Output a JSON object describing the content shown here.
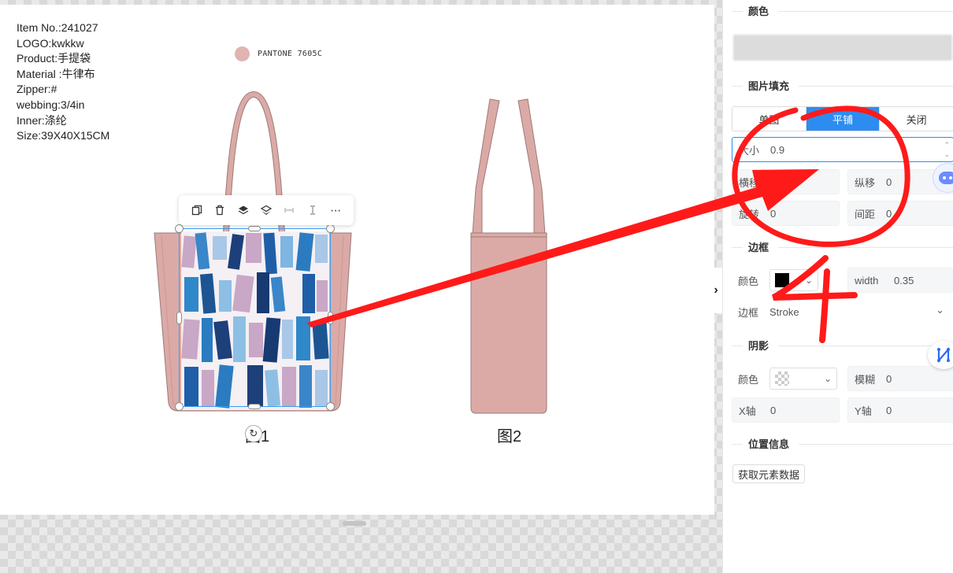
{
  "spec": {
    "lines": [
      "Item No.:241027",
      "LOGO:kwkkw",
      "Product:手提袋",
      "Material :牛律布",
      "Zipper:#",
      "webbing:3/4in",
      "Inner:涤纶",
      "Size:39X40X15CM"
    ]
  },
  "pantone": {
    "code": "PANTONE 7605C",
    "color": "#e0b4b0"
  },
  "figures": {
    "fig1": "图1",
    "fig2": "图2"
  },
  "toolbar": {
    "icons": [
      "copy-icon",
      "delete-icon",
      "layer-up-icon",
      "layer-down-icon",
      "align-horizontal-icon",
      "align-vertical-icon",
      "more-icon"
    ]
  },
  "panel": {
    "color_section": "颜色",
    "image_fill_section": "图片填充",
    "fill_modes": [
      "单图",
      "平铺",
      "关闭"
    ],
    "active_fill_mode": "平铺",
    "size_label": "大小",
    "size_value": "0.9",
    "offset_x_label": "横移",
    "offset_x_value": "0",
    "offset_y_label": "纵移",
    "offset_y_value": "0",
    "rotate_label": "旋转",
    "rotate_value": "0",
    "spacing_label": "间距",
    "spacing_value": "0",
    "border_section": "边框",
    "border_color_label": "颜色",
    "border_color": "#000000",
    "border_width_label": "width",
    "border_width_value": "0.35",
    "border_style_label": "边框",
    "border_style_value": "Stroke",
    "shadow_section": "阴影",
    "shadow_color_label": "颜色",
    "shadow_blur_label": "模糊",
    "shadow_blur_value": "0",
    "shadow_x_label": "X轴",
    "shadow_x_value": "0",
    "shadow_y_label": "Y轴",
    "shadow_y_value": "0",
    "position_section": "位置信息",
    "get_data_button": "获取元素数据"
  },
  "annotation": {
    "number": "4",
    "color": "#ff1a1a"
  },
  "colors": {
    "bag": "#dcaaa6",
    "bag_stroke": "#9a7a78",
    "accent": "#2d8cf0"
  }
}
